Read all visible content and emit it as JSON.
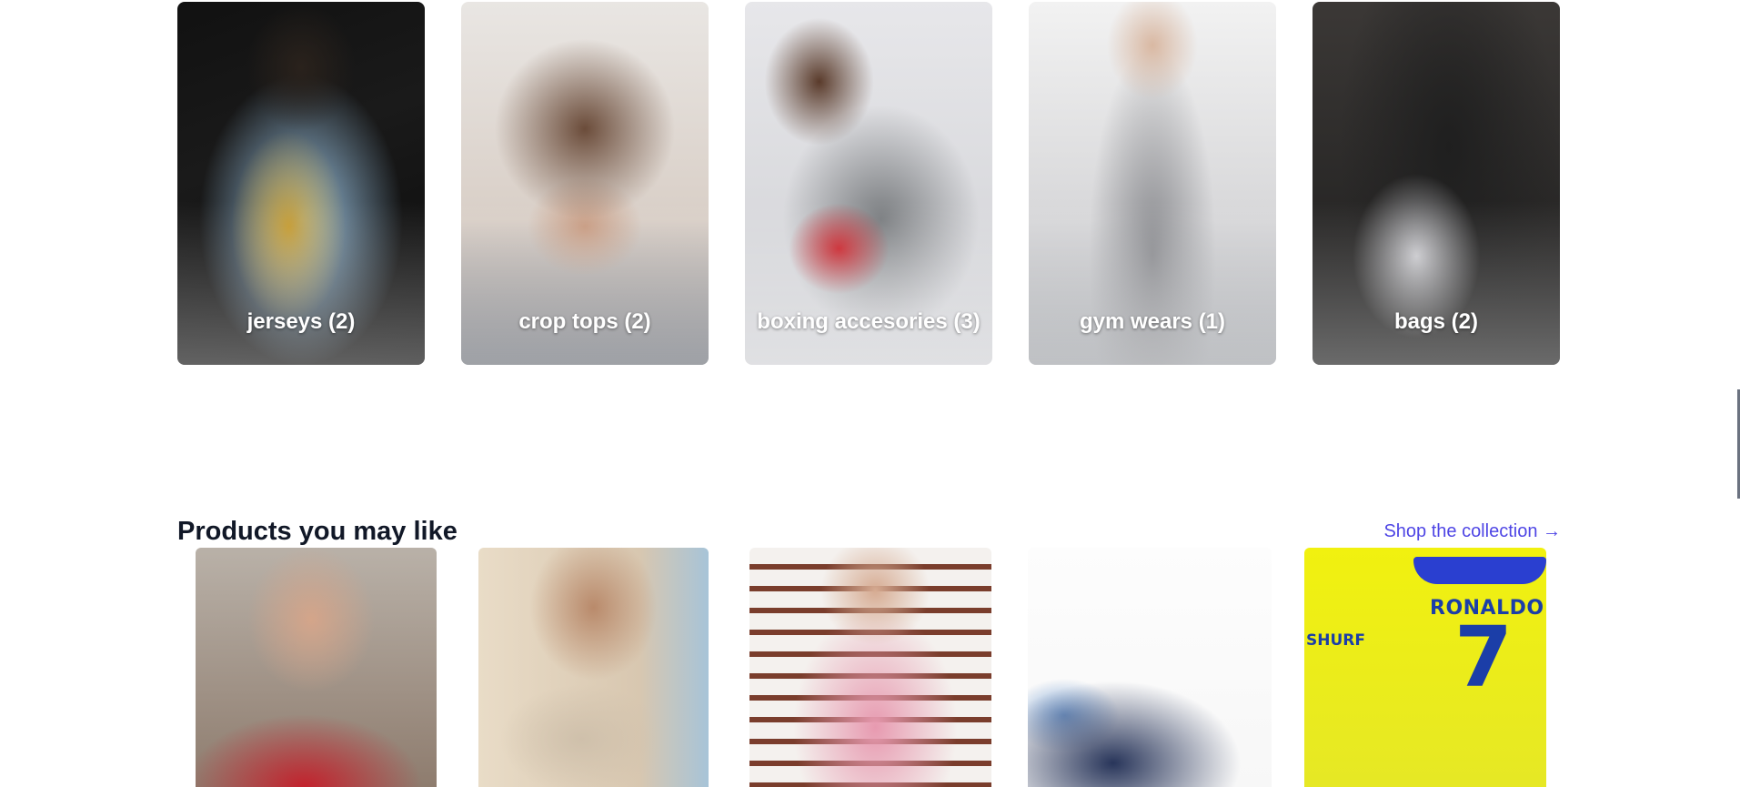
{
  "categories": [
    {
      "label": "jerseys (2)"
    },
    {
      "label": "crop tops (2)"
    },
    {
      "label": "boxing accesories (3)"
    },
    {
      "label": "gym wears (1)"
    },
    {
      "label": "bags (2)"
    }
  ],
  "products_section": {
    "title": "Products you may like",
    "shop_link": "Shop the collection →"
  },
  "products": [
    {
      "image": "woman-red-saree"
    },
    {
      "image": "woman-embroidered-lehenga"
    },
    {
      "image": "woman-pink-salwar-suit"
    },
    {
      "image": "navy-blue-high-top-sneaker"
    },
    {
      "image": "yellow-football-jersey",
      "jersey_name": "RONALDO",
      "jersey_number": "7",
      "jersey_sponsor": "SHURF"
    }
  ]
}
